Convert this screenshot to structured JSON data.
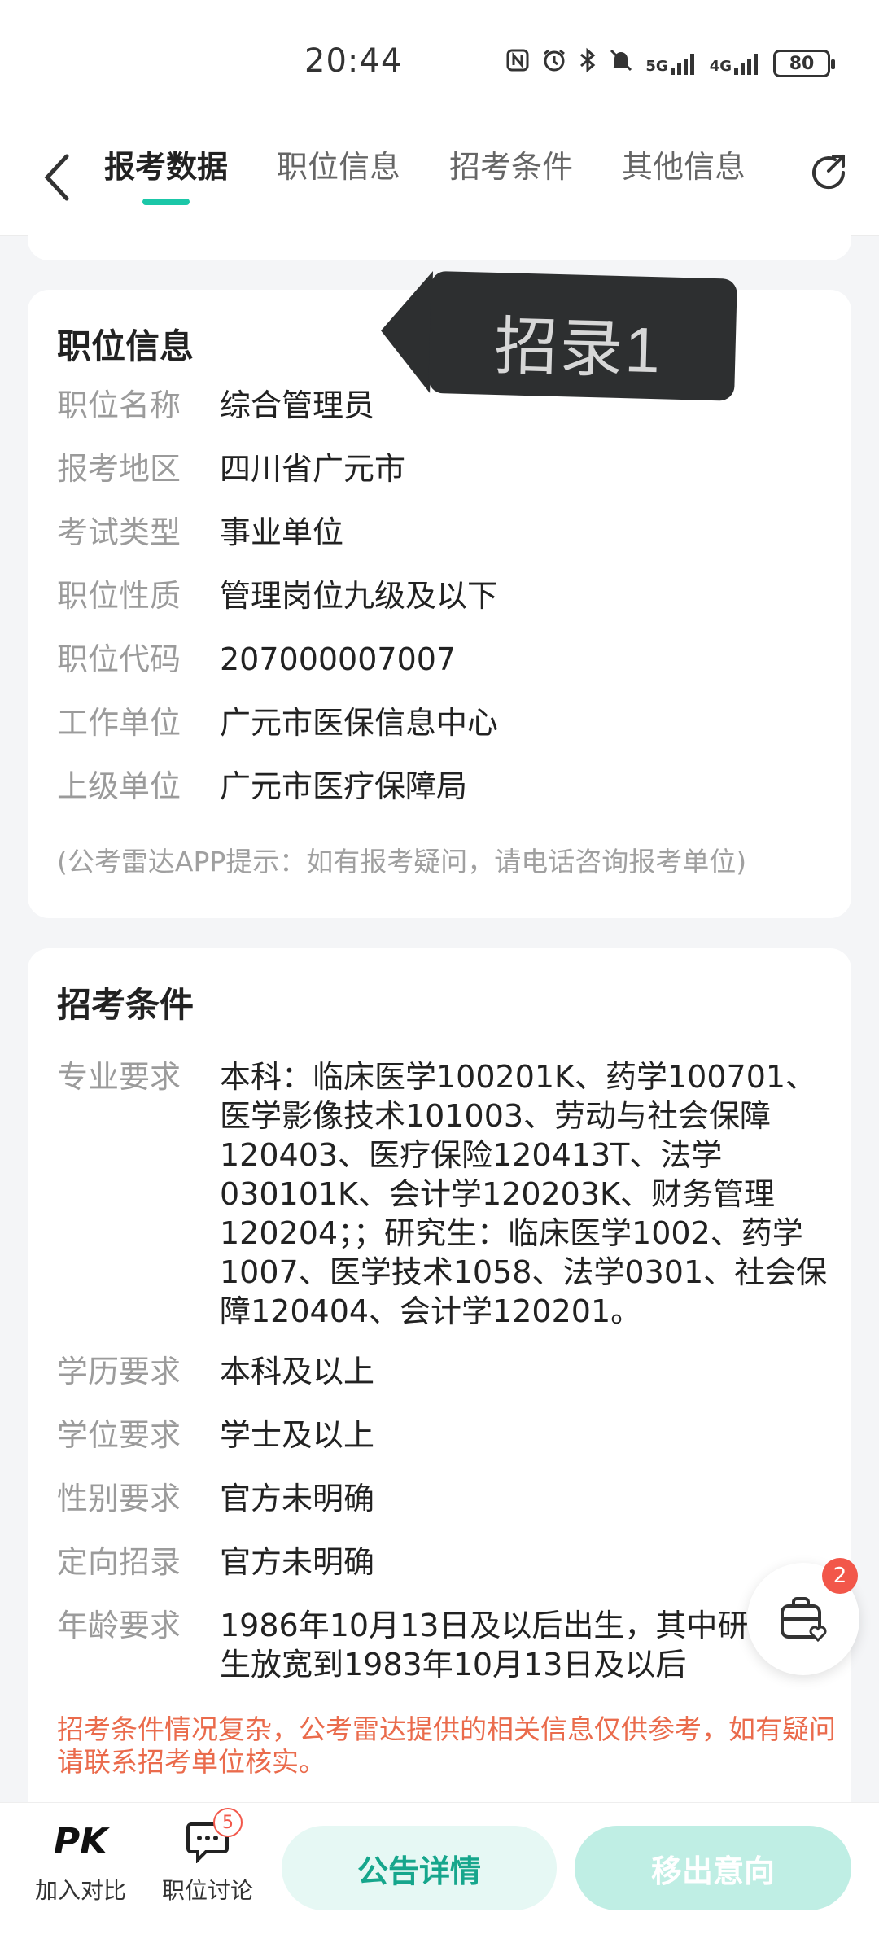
{
  "status_bar": {
    "time": "20:44",
    "battery": "80",
    "signal_5g": "5G",
    "signal_4g": "4G",
    "icons": [
      "nfc-icon",
      "alarm-icon",
      "bluetooth-icon",
      "mute-icon",
      "signal-5g-icon",
      "signal-4g-icon",
      "battery-icon"
    ]
  },
  "header": {
    "tabs": [
      {
        "label": "报考数据",
        "active": true
      },
      {
        "label": "职位信息",
        "active": false
      },
      {
        "label": "招考条件",
        "active": false
      },
      {
        "label": "其他信息",
        "active": false
      }
    ],
    "accent": "#1bc7a8"
  },
  "callout": {
    "text": "招录1"
  },
  "position_info": {
    "title": "职位信息",
    "rows": [
      {
        "label": "职位名称",
        "value": "综合管理员"
      },
      {
        "label": "报考地区",
        "value": "四川省广元市"
      },
      {
        "label": "考试类型",
        "value": "事业单位"
      },
      {
        "label": "职位性质",
        "value": "管理岗位九级及以下"
      },
      {
        "label": "职位代码",
        "value": "207000007007"
      },
      {
        "label": "工作单位",
        "value": "广元市医保信息中心"
      },
      {
        "label": "上级单位",
        "value": "广元市医疗保障局"
      }
    ],
    "hint": "(公考雷达APP提示：如有报考疑问，请电话咨询报考单位)"
  },
  "conditions": {
    "title": "招考条件",
    "major": {
      "label": "专业要求",
      "value": "本科：临床医学100201K、药学100701、医学影像技术101003、劳动与社会保障120403、医疗保险120413T、法学030101K、会计学120203K、财务管理120204；；研究生：临床医学1002、药学1007、医学技术1058、法学0301、社会保障120404、会计学120201。"
    },
    "rows": [
      {
        "label": "学历要求",
        "value": "本科及以上"
      },
      {
        "label": "学位要求",
        "value": "学士及以上"
      },
      {
        "label": "性别要求",
        "value": "官方未明确"
      },
      {
        "label": "定向招录",
        "value": "官方未明确"
      }
    ],
    "age": {
      "label": "年龄要求",
      "value": "1986年10月13日及以后出生，其中研究生放宽到1983年10月13日及以后"
    },
    "warning": "招考条件情况复杂，公考雷达提供的相关信息仅供参考，如有疑问请联系招考单位核实。",
    "warning_color": "#ea6b4c"
  },
  "floating": {
    "badge": "2"
  },
  "bottom_bar": {
    "compare_icon": "PK",
    "compare_label": "加入对比",
    "discuss_label": "职位讨论",
    "discuss_badge": "5",
    "detail_button": "公告详情",
    "remove_button": "移出意向"
  }
}
